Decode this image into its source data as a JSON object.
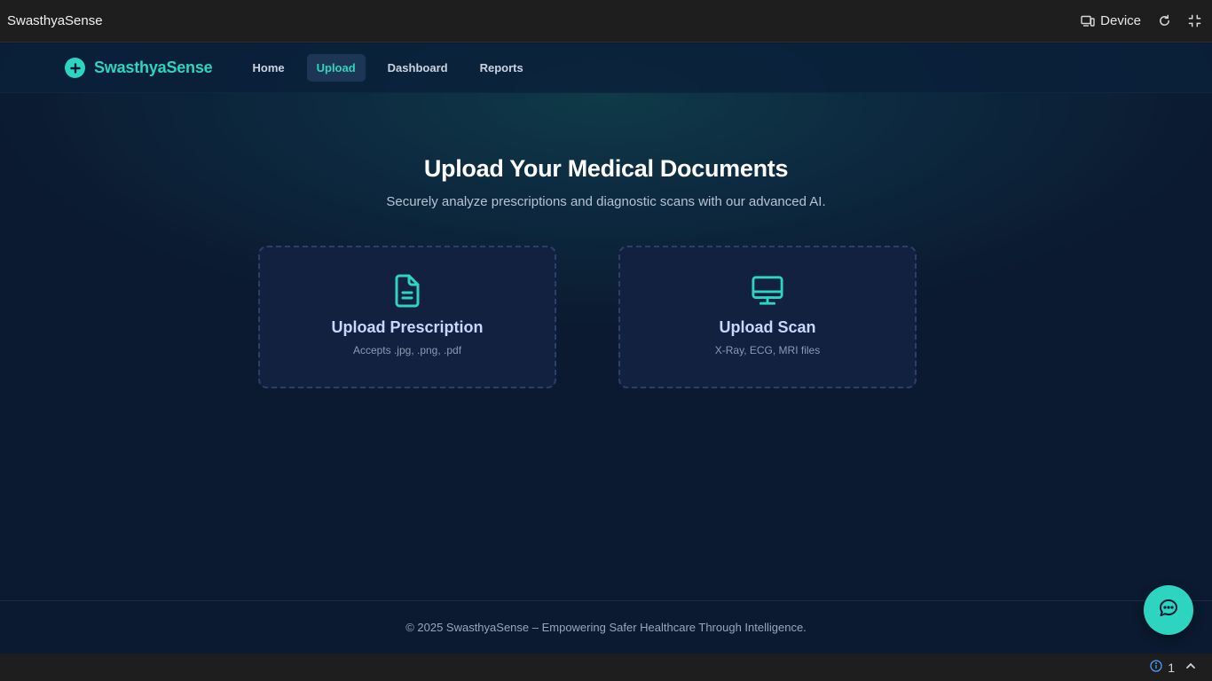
{
  "window": {
    "title": "SwasthyaSense",
    "device_label": "Device",
    "icons": [
      "device-icon",
      "refresh-icon",
      "collapse-icon"
    ]
  },
  "nav": {
    "brand": "SwasthyaSense",
    "links": [
      {
        "label": "Home",
        "active": false
      },
      {
        "label": "Upload",
        "active": true
      },
      {
        "label": "Dashboard",
        "active": false
      },
      {
        "label": "Reports",
        "active": false
      }
    ]
  },
  "hero": {
    "title": "Upload Your Medical Documents",
    "subtitle": "Securely analyze prescriptions and diagnostic scans with our advanced AI."
  },
  "cards": [
    {
      "title": "Upload Prescription",
      "subtitle": "Accepts .jpg, .png, .pdf",
      "icon": "document-icon"
    },
    {
      "title": "Upload Scan",
      "subtitle": "X-Ray, ECG, MRI files",
      "icon": "monitor-icon"
    }
  ],
  "footer": {
    "text": "© 2025 SwasthyaSense – Empowering Safer Healthcare Through Intelligence."
  },
  "status_bar": {
    "info_count": "1"
  },
  "colors": {
    "accent": "#2dd4bf",
    "background": "#0b1a30",
    "card_bg": "#11213f",
    "card_title": "#c7d7ff"
  }
}
